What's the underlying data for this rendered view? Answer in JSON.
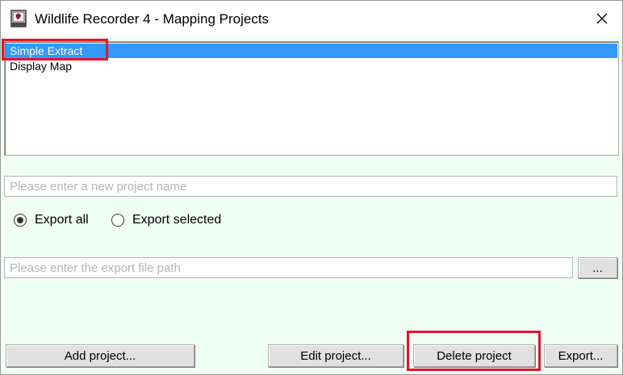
{
  "window": {
    "title": "Wildlife Recorder 4 - Mapping Projects",
    "close_icon": "close-icon"
  },
  "projects": {
    "items": [
      {
        "label": "Simple Extract",
        "selected": true
      },
      {
        "label": "Display Map",
        "selected": false
      }
    ]
  },
  "project_name": {
    "placeholder": "Please enter a new project name",
    "value": ""
  },
  "export_mode": {
    "options": [
      {
        "label": "Export all",
        "checked": true
      },
      {
        "label": "Export selected",
        "checked": false
      }
    ]
  },
  "export_path": {
    "placeholder": "Please enter the export file path",
    "value": "",
    "browse_label": "..."
  },
  "buttons": {
    "add": "Add project...",
    "edit": "Edit project...",
    "delete": "Delete project",
    "export": "Export..."
  },
  "colors": {
    "selection": "#3399ff",
    "highlight": "#e8132a",
    "background": "#f0fff4"
  }
}
